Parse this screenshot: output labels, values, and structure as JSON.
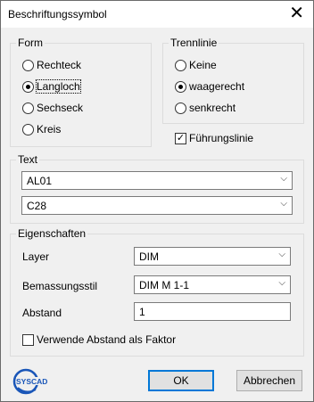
{
  "window": {
    "title": "Beschriftungssymbol",
    "close_glyph": "✕"
  },
  "form": {
    "label": "Form",
    "options": [
      "Rechteck",
      "Langloch",
      "Sechseck",
      "Kreis"
    ],
    "selected": "Langloch"
  },
  "trennlinie": {
    "label": "Trennlinie",
    "options": [
      "Keine",
      "waagerecht",
      "senkrecht"
    ],
    "selected": "waagerecht"
  },
  "fuehrungslinie": {
    "label": "Führungslinie",
    "checked": true
  },
  "text": {
    "label": "Text",
    "line1": "AL01",
    "line2": "C28"
  },
  "eigenschaften": {
    "label": "Eigenschaften",
    "layer_label": "Layer",
    "layer_value": "DIM",
    "bemassungsstil_label": "Bemassungsstil",
    "bemassungsstil_value": "DIM M 1-1",
    "abstand_label": "Abstand",
    "abstand_value": "1",
    "faktor_label": "Verwende Abstand als Faktor",
    "faktor_checked": false
  },
  "buttons": {
    "ok": "OK",
    "cancel": "Abbrechen"
  },
  "logo": {
    "text": "SYSCAD",
    "color": "#1a56b8"
  },
  "icons": {
    "chevron": "chevron-down-icon",
    "check": "check-icon"
  }
}
